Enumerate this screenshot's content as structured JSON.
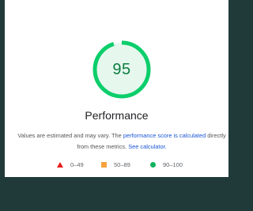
{
  "colors": {
    "background": "#203a3a",
    "card": "#ffffff",
    "gauge_ring": "#0cce6b",
    "gauge_fill": "#e6f7ee",
    "score_text": "#0a7e3f",
    "link": "#1a56d6",
    "legend_fail": "#e81e1e",
    "legend_average": "#f6a33c",
    "legend_pass": "#10b15e"
  },
  "gauge": {
    "score": "95",
    "score_fraction": 0.95,
    "category_title": "Performance"
  },
  "description": {
    "text_before": "Values are estimated and may vary. The ",
    "link1": "performance score is calculated",
    "text_middle": " directly from these metrics. ",
    "link2": "See calculator."
  },
  "legend": [
    {
      "icon": "triangle-icon",
      "label": "0–49"
    },
    {
      "icon": "square-icon",
      "label": "50–89"
    },
    {
      "icon": "circle-icon",
      "label": "90–100"
    }
  ]
}
